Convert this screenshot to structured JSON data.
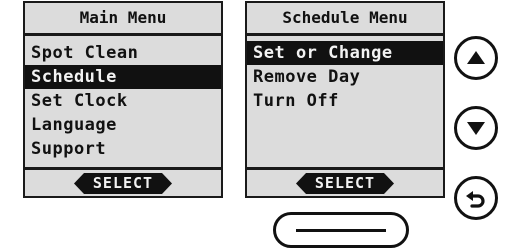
{
  "main_menu": {
    "title": "Main Menu",
    "items": [
      {
        "label": "Spot Clean",
        "selected": false
      },
      {
        "label": "Schedule",
        "selected": true
      },
      {
        "label": "Set Clock",
        "selected": false
      },
      {
        "label": "Language",
        "selected": false
      },
      {
        "label": "Support",
        "selected": false
      }
    ],
    "softkey_label": "SELECT"
  },
  "schedule_menu": {
    "title": "Schedule Menu",
    "items": [
      {
        "label": "Set or Change",
        "selected": true
      },
      {
        "label": "Remove Day",
        "selected": false
      },
      {
        "label": "Turn Off",
        "selected": false
      }
    ],
    "softkey_label": "SELECT"
  },
  "buttons": {
    "up_icon": "triangle-up-icon",
    "down_icon": "triangle-down-icon",
    "back_icon": "back-arrow-icon",
    "home_icon": "horizontal-bar-icon"
  },
  "colors": {
    "screen_background": "#dcdcdc",
    "foreground": "#111111",
    "highlight_text": "#f2f2f2"
  }
}
